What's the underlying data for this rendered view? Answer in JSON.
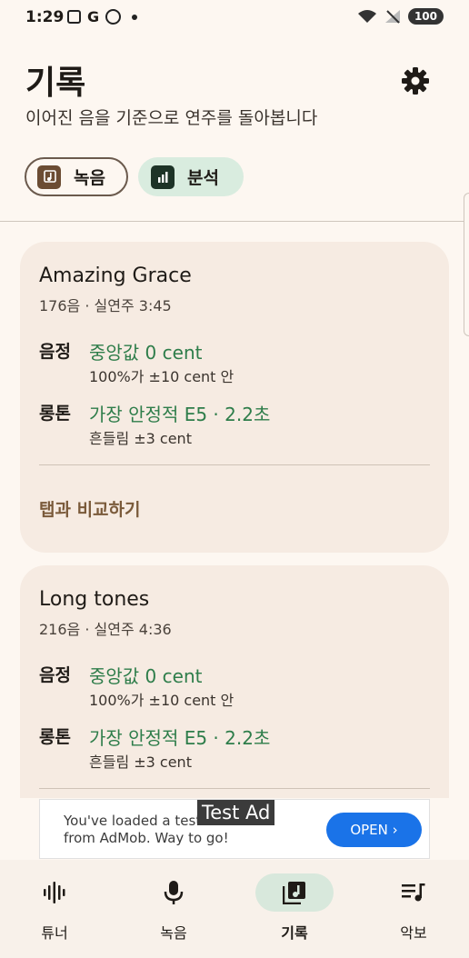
{
  "status": {
    "time": "1:29",
    "g": "G",
    "battery": "100"
  },
  "header": {
    "title": "기록",
    "subtitle": "이어진 음을 기준으로 연주를 돌아봅니다"
  },
  "segments": {
    "record": "녹음",
    "analysis": "분석"
  },
  "cards": [
    {
      "title": "Amazing Grace",
      "meta": "176음 · 실연주 3:45",
      "pitch_label": "음정",
      "pitch_value": "중앙값 0 cent",
      "pitch_sub": "100%가 ±10 cent 안",
      "longtone_label": "롱톤",
      "longtone_value": "가장 안정적 E5 · 2.2초",
      "longtone_sub": "흔들림 ±3 cent",
      "compare": "탭과 비교하기"
    },
    {
      "title": "Long tones",
      "meta": "216음 · 실연주 4:36",
      "pitch_label": "음정",
      "pitch_value": "중앙값 0 cent",
      "pitch_sub": "100%가 ±10 cent 안",
      "longtone_label": "롱톤",
      "longtone_value": "가장 안정적 E5 · 2.2초",
      "longtone_sub": "흔들림 ±3 cent"
    }
  ],
  "ad": {
    "text": "You've loaded a test ad from AdMob. Way to go!",
    "badge": "Test Ad",
    "button": "OPEN ›"
  },
  "nav": {
    "tuner": "튜너",
    "record": "녹음",
    "history": "기록",
    "sheet": "악보"
  },
  "colors": {
    "accent_green": "#2e7d4a",
    "compare_brown": "#7a5a3a",
    "ad_blue": "#1a73e8"
  }
}
